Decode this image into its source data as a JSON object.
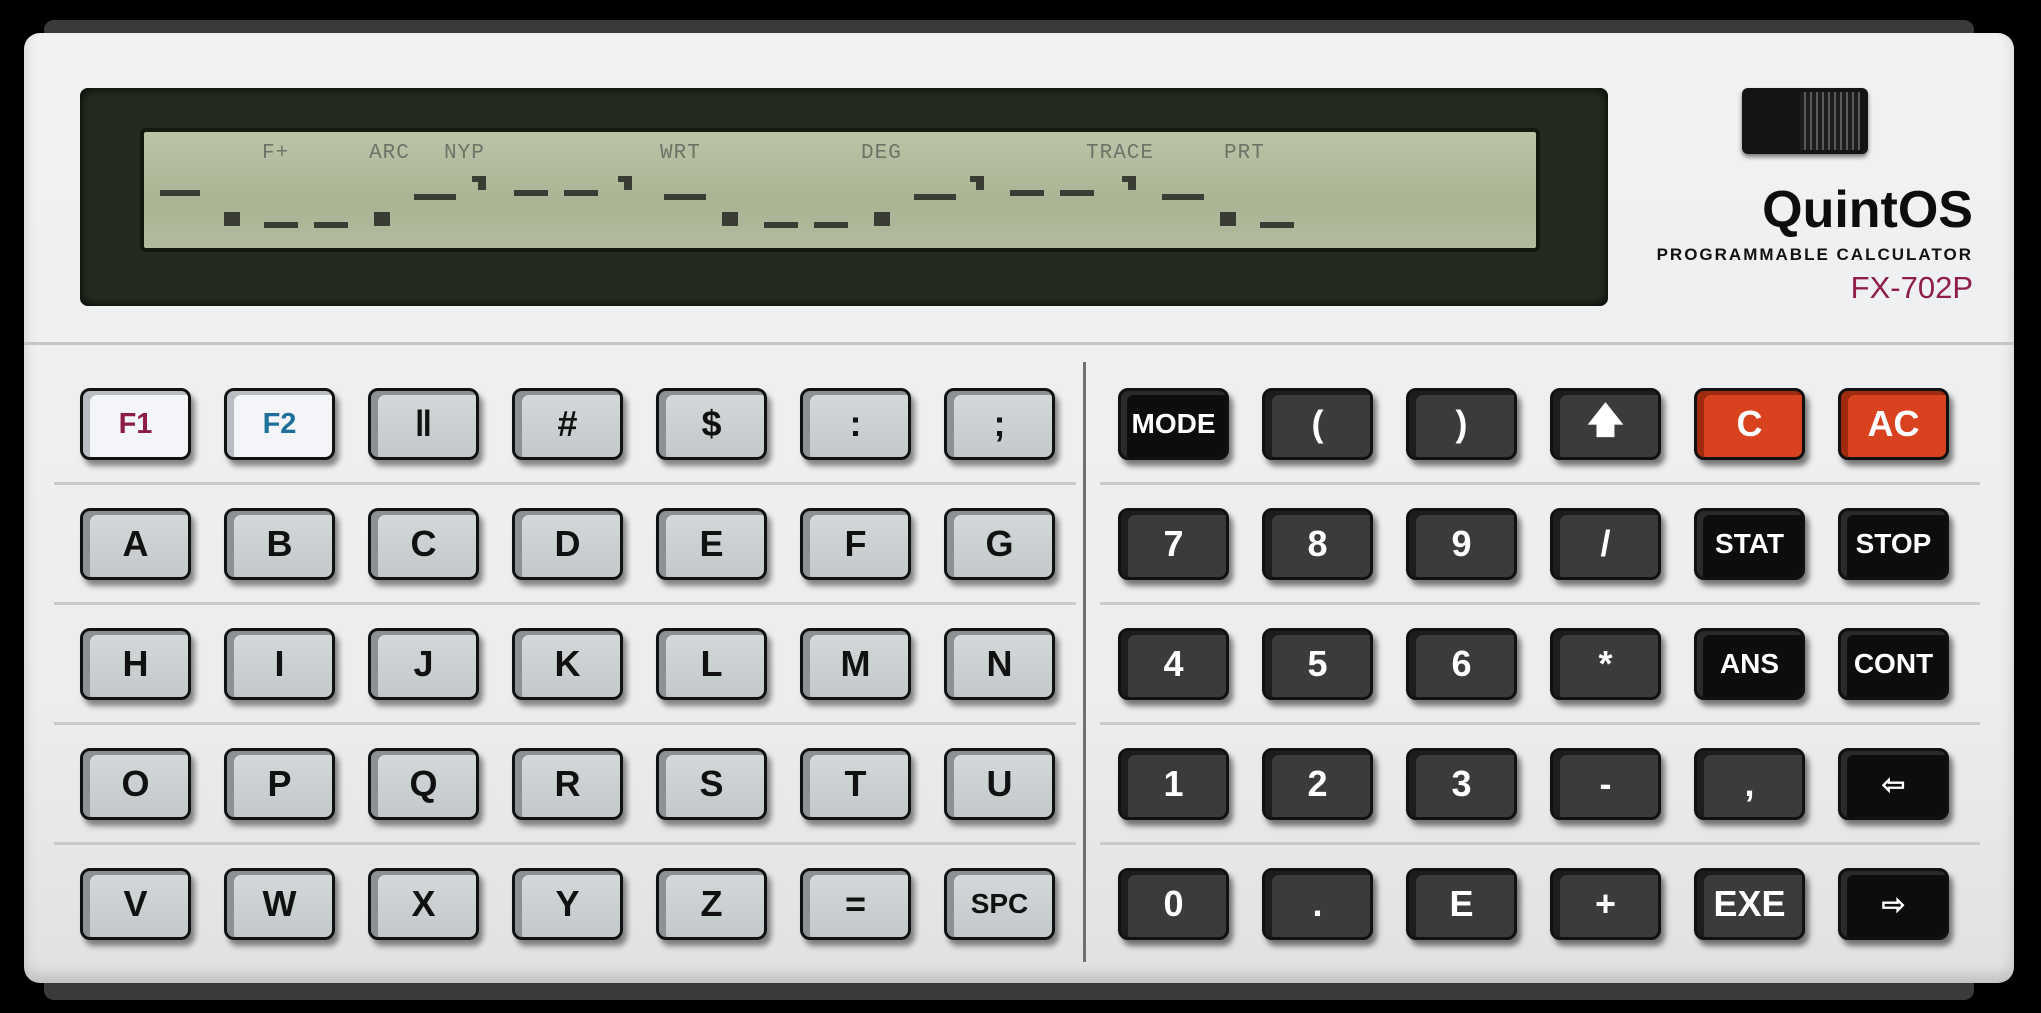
{
  "device": {
    "brand": "QuintOS",
    "subtitle": "PROGRAMMABLE CALCULATOR",
    "model": "FX-702P"
  },
  "display": {
    "annunciators": [
      "F+",
      "ARC",
      "NYP",
      "WRT",
      "DEG",
      "TRACE",
      "PRT"
    ]
  },
  "keys": {
    "left": [
      [
        "F1",
        "F2",
        "‖",
        "#",
        "$",
        ":",
        ";"
      ],
      [
        "A",
        "B",
        "C",
        "D",
        "E",
        "F",
        "G"
      ],
      [
        "H",
        "I",
        "J",
        "K",
        "L",
        "M",
        "N"
      ],
      [
        "O",
        "P",
        "Q",
        "R",
        "S",
        "T",
        "U"
      ],
      [
        "V",
        "W",
        "X",
        "Y",
        "Z",
        "=",
        "SPC"
      ]
    ],
    "right": [
      [
        "MODE",
        "(",
        ")",
        "🡅",
        "C",
        "AC"
      ],
      [
        "7",
        "8",
        "9",
        "/",
        "STAT",
        "STOP"
      ],
      [
        "4",
        "5",
        "6",
        "*",
        "ANS",
        "CONT"
      ],
      [
        "1",
        "2",
        "3",
        "-",
        ",",
        "⇦"
      ],
      [
        "0",
        ".",
        "E",
        "+",
        "EXE",
        "⇨"
      ]
    ]
  },
  "colors": {
    "f1": "#8b1d47",
    "f2": "#1e6f9a",
    "clear_keys": "#d8421e",
    "model": "#8f1e4a"
  }
}
